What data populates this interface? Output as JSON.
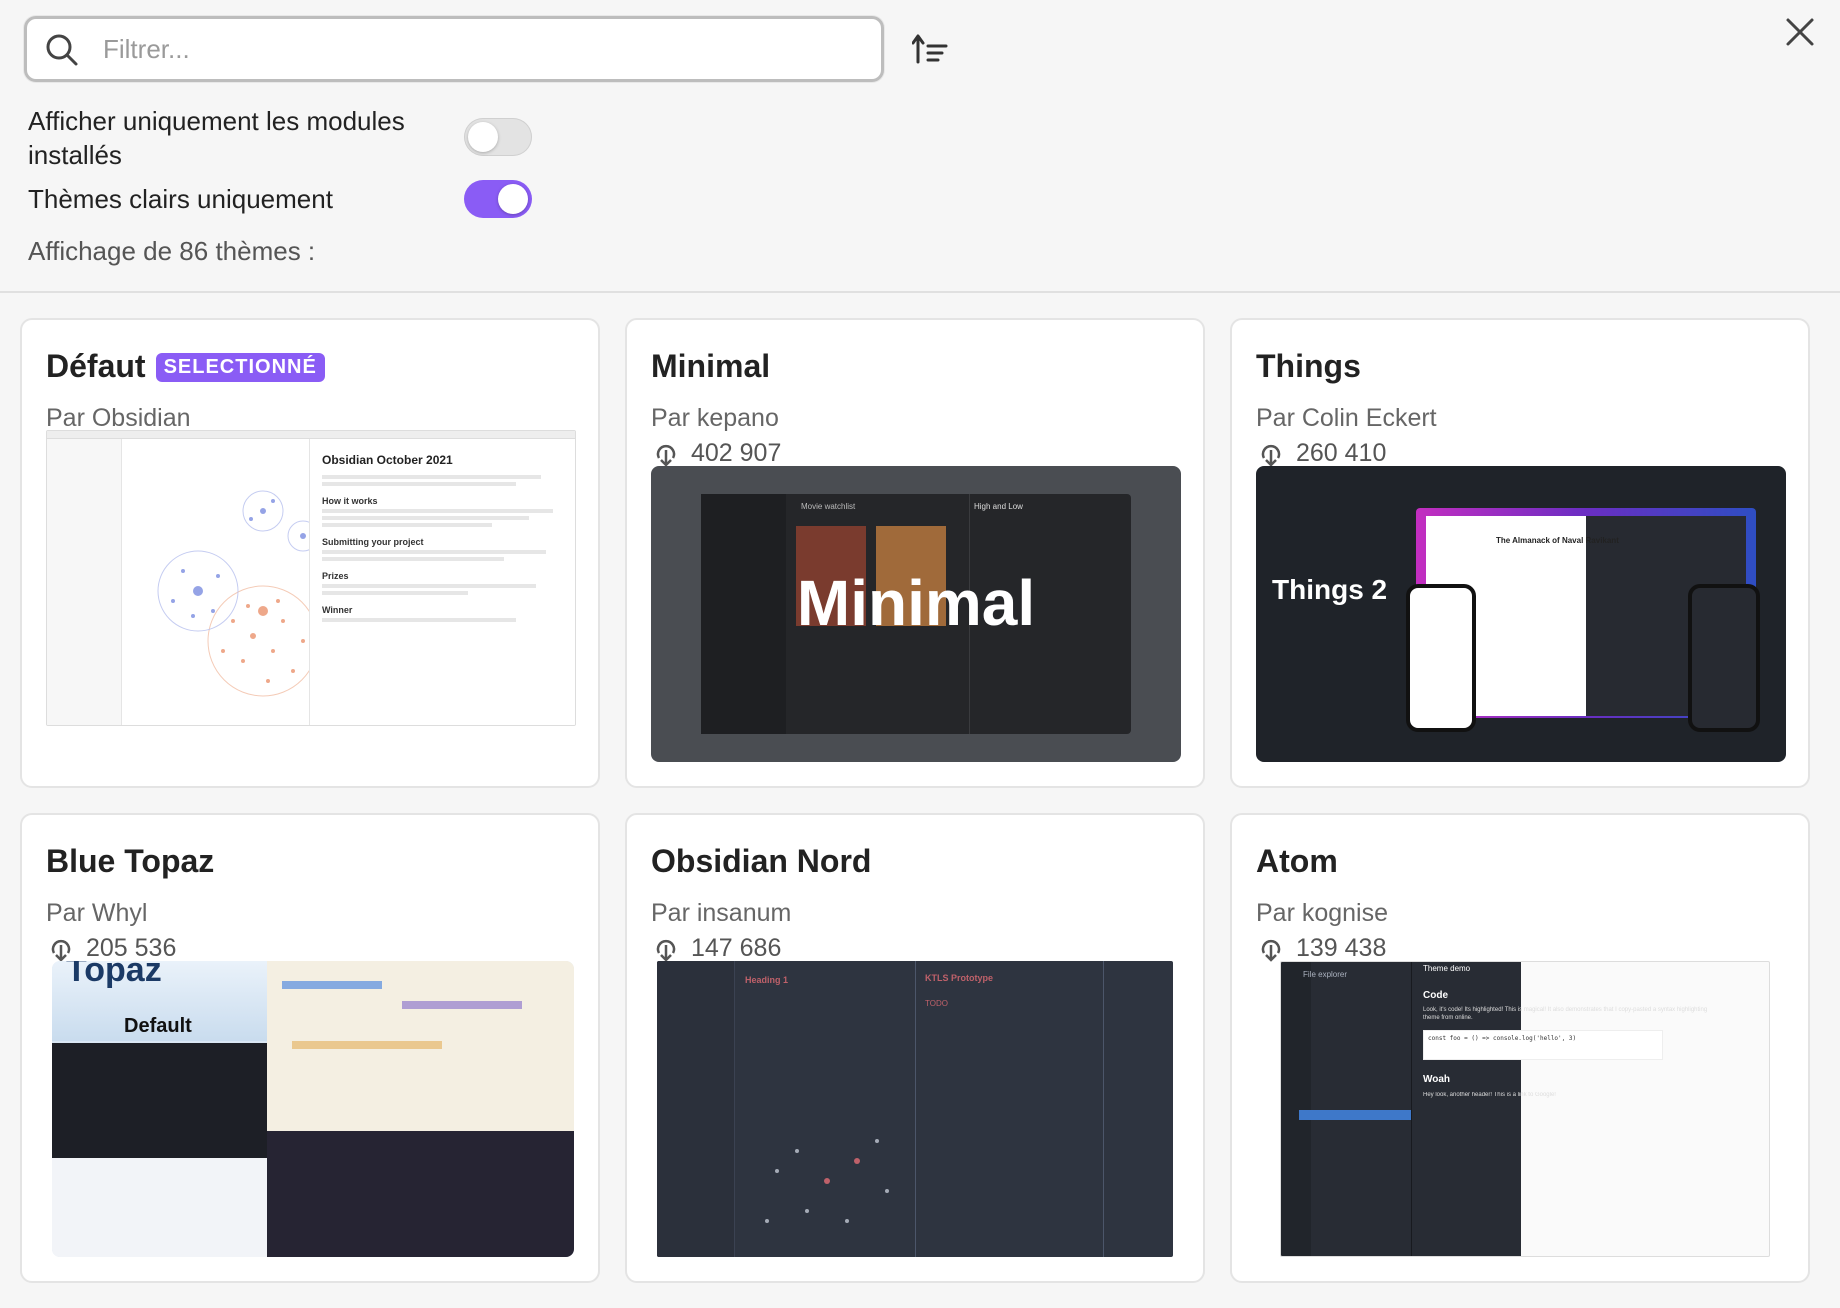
{
  "search": {
    "placeholder": "Filtrer..."
  },
  "settings": {
    "installed_only_label_line1": "Afficher uniquement les modules",
    "installed_only_label_line2": "installés",
    "installed_only": false,
    "light_only_label": "Thèmes clairs uniquement",
    "light_only": true
  },
  "count_text": "Affichage de 86 thèmes :",
  "accent_color": "#8a5cf5",
  "themes": [
    {
      "name": "Défaut",
      "badge": "SELECTIONNÉ",
      "author": "Par Obsidian",
      "downloads": null,
      "preview": {
        "doc_title": "Obsidian October 2021",
        "sections": [
          "How it works",
          "Submitting your project",
          "Prizes",
          "Winner"
        ]
      }
    },
    {
      "name": "Minimal",
      "author": "Par kepano",
      "downloads": "402 907",
      "preview": {
        "overlay_text": "Minimal",
        "pane_title": "Movie watchlist",
        "note_title": "High and Low"
      }
    },
    {
      "name": "Things",
      "author": "Par Colin Eckert",
      "downloads": "260 410",
      "preview": {
        "overlay_text": "Things 2",
        "note_title": "The Almanack of Naval Ravikant"
      }
    },
    {
      "name": "Blue Topaz",
      "author": "Par Whyl",
      "downloads": "205 536",
      "preview": {
        "banner_text": "Topaz",
        "label": "Default"
      }
    },
    {
      "name": "Obsidian Nord",
      "author": "Par insanum",
      "downloads": "147 686",
      "preview": {
        "heading": "Heading 1",
        "note_title": "KTLS Prototype",
        "todo": "TODO"
      }
    },
    {
      "name": "Atom",
      "author": "Par kognise",
      "downloads": "139 438",
      "preview": {
        "explorer": "File explorer",
        "tab": "Theme demo",
        "h1": "Code",
        "h2": "Woah",
        "code": "const foo = () => console.log('hello', 3)",
        "text1": "Look, it's code! Its highlighted! This is magical! It also demonstrates that I copy-pasted a syntax highlighting theme from online.",
        "text2": "Hey look, another header! This is a link to Google!"
      }
    }
  ]
}
